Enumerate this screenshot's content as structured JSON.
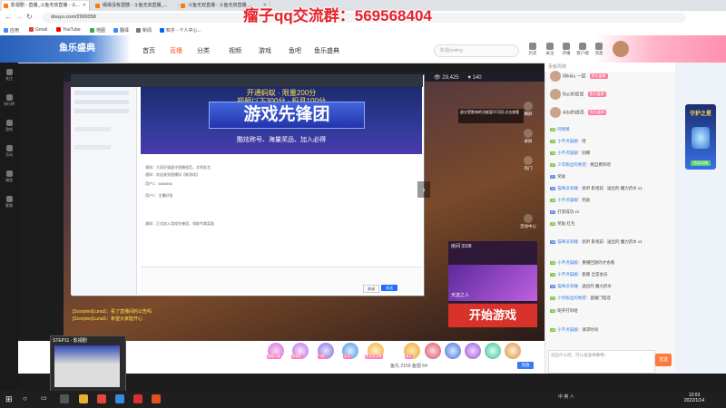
{
  "browser": {
    "tabs": [
      {
        "label": "影视剧 - 直播_斗鱼无双直播 - 斗..."
      },
      {
        "label": "缘缘没有遗憾 - 斗鱼无双直播_..."
      },
      {
        "label": "斗鱼无双直播 - 斗鱼无双直播_..."
      }
    ],
    "url": "douyu.com/2999358",
    "bookmarks": [
      "应用",
      "Gmail",
      "YouTube",
      "地图",
      "翻译",
      "新闻",
      "知乎 - 个人中心..."
    ],
    "bookmark_colors": [
      "#4a8af4",
      "#db4437",
      "#ff0000",
      "#34a853",
      "#4285f4",
      "#777777",
      "#0066ff"
    ]
  },
  "overlay_text": "瘤子qq交流群：569568404",
  "douyu": {
    "nav": [
      "首页",
      "直播",
      "分类",
      "视频",
      "游戏",
      "鱼吧",
      "鱼乐盛典"
    ],
    "nav_active": "直播",
    "search_placeholder": "影视rewing",
    "header_icons": [
      "历史",
      "关注",
      "开播",
      "客户端",
      "消息"
    ],
    "banner_left": "鱼乐盛典"
  },
  "left_sidebar": [
    "关注",
    "排行榜",
    "游戏",
    "活动",
    "福袋",
    "客服"
  ],
  "stream": {
    "viewer_count": "29,425",
    "fans": "140",
    "captured_window": {
      "banner_top_line1": "开通蚂蚁 · 限量200分",
      "banner_top_line2": "视频以下300分 · 蚂月100分",
      "banner_title": "游戏先锋团",
      "banner_sub": "酷炫称号、海量奖品、加入必得",
      "chat_lines": [
        "通知：大家好请遵守直播规范，文明发言",
        "通知：欢迎来到直播间【新游戏】",
        "用户1：6666666",
        "用户2：主播好强",
        "通知：正式加入游戏先锋团，领取专属奖励"
      ],
      "close_label": "关闭",
      "send_label": "发送"
    },
    "notice_text": "部分受影响的功能暂不可用 点击查看",
    "controls": [
      "横屏",
      "录屏",
      "热门",
      "活动中心",
      "鱼吧大厅"
    ],
    "card_label": "房间 3338",
    "card_title": "天选之人",
    "start_game": "开始游戏",
    "danmu": [
      "[Scorpion]LunaS：看了直播间的公告吗",
      "[Scorpion]LunaS：希望大家能开心"
    ]
  },
  "below_video": {
    "gifts": [
      "超级火箭",
      "穿梭机",
      "飞机",
      "办卡",
      "粉丝荧光棒",
      "鱼丸"
    ],
    "stats": "鱼丸 2159   鱼翅 64",
    "recharge": "充值"
  },
  "chat": {
    "title": "贡献周榜",
    "rank": [
      {
        "name": "Mikkiu 一起",
        "badge": "鱼乐盛典"
      },
      {
        "name": "Buc的星星",
        "badge": "鱼乐盛典"
      },
      {
        "name": "Ada的成员",
        "badge": "鱼乐盛典"
      }
    ],
    "messages": [
      {
        "level": "20",
        "name": "阿明黄",
        "text": ""
      },
      {
        "level": "14",
        "name": "小不点猫娘：",
        "text": "哈"
      },
      {
        "level": "14",
        "name": "小不点猫娘：",
        "text": "别哪"
      },
      {
        "level": "22",
        "name": "少年粉丝的希望：",
        "text": "要自费的吧"
      },
      {
        "level": "21",
        "name": "",
        "text": "奖励"
      },
      {
        "level": "12",
        "name": "猫咪没有睡：",
        "text": "悉听 影视前 · 送出的 魔力药水 x1"
      },
      {
        "level": "14",
        "name": "小不点猫娘：",
        "text": "奖励"
      },
      {
        "level": "21",
        "name": "",
        "text": "打赏成功 x1"
      },
      {
        "level": "25",
        "name": "",
        "text": "奖励 红包"
      },
      {
        "level": "13",
        "name": "猫咪没有睡：",
        "text": "悉听 影视前 · 送出的 魔力药水 x1"
      },
      {
        "level": "14",
        "name": "小不点猫娘：",
        "text": "重播回放的才会看"
      },
      {
        "level": "14",
        "name": "小不点猫娘：",
        "text": "套路 全是会员"
      },
      {
        "level": "12",
        "name": "猫咪没有睡：",
        "text": "送出的 魔力药水"
      },
      {
        "level": "21",
        "name": "少年粉丝的希望：",
        "text": "直播门电话"
      },
      {
        "level": "15",
        "name": "",
        "text": "呢开打吗哈"
      },
      {
        "level": "14",
        "name": "小不点猫娘：",
        "text": "请求时间"
      }
    ],
    "input_placeholder": "说些什么吧，可以发送弹幕哦~",
    "send_label": "发送"
  },
  "ad": {
    "title": "守护之星",
    "button": "活动详情"
  },
  "thumbnail": {
    "title": "STEP11 · 影视剧"
  },
  "taskbar": {
    "tray_text": "中 英 ∧",
    "time": "12:03",
    "date": "2022/1/14"
  },
  "colors": {
    "accent": "#ff5d23",
    "start_game": "#d8322b",
    "overlay_red": "#e8222b"
  }
}
